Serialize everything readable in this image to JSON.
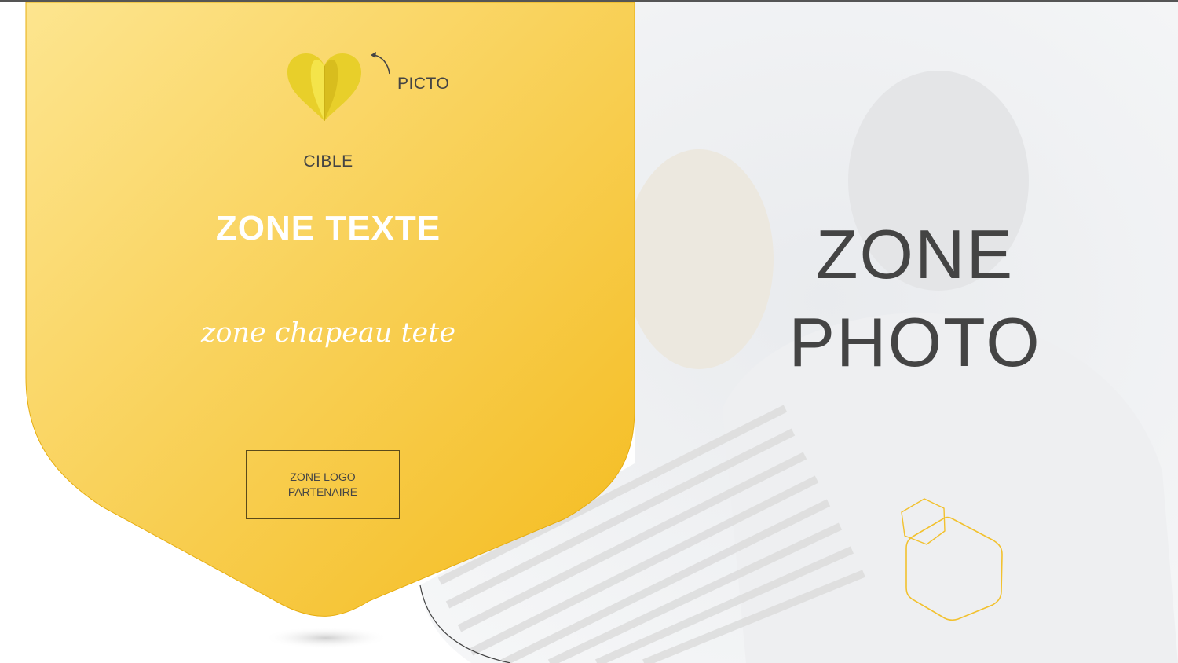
{
  "template": {
    "picto_label": "PICTO",
    "cible_label": "CIBLE",
    "zone_texte": "ZONE TEXTE",
    "zone_chapeau": "zone chapeau tete",
    "logo_partenaire": {
      "line1": "ZONE LOGO",
      "line2": "PARTENAIRE"
    },
    "zone_photo": {
      "line1": "ZONE",
      "line2": "PHOTO"
    }
  },
  "icons": {
    "picto": "heart-icon",
    "arrow": "curved-arrow-icon",
    "hexagons": "hexagon-outline-icon"
  },
  "colors": {
    "yellow_light": "#fde58f",
    "yellow_dark": "#f4bb1d",
    "hexagon_stroke": "#f2c12e",
    "text_dark": "#444444",
    "text_light": "#ffffff"
  }
}
